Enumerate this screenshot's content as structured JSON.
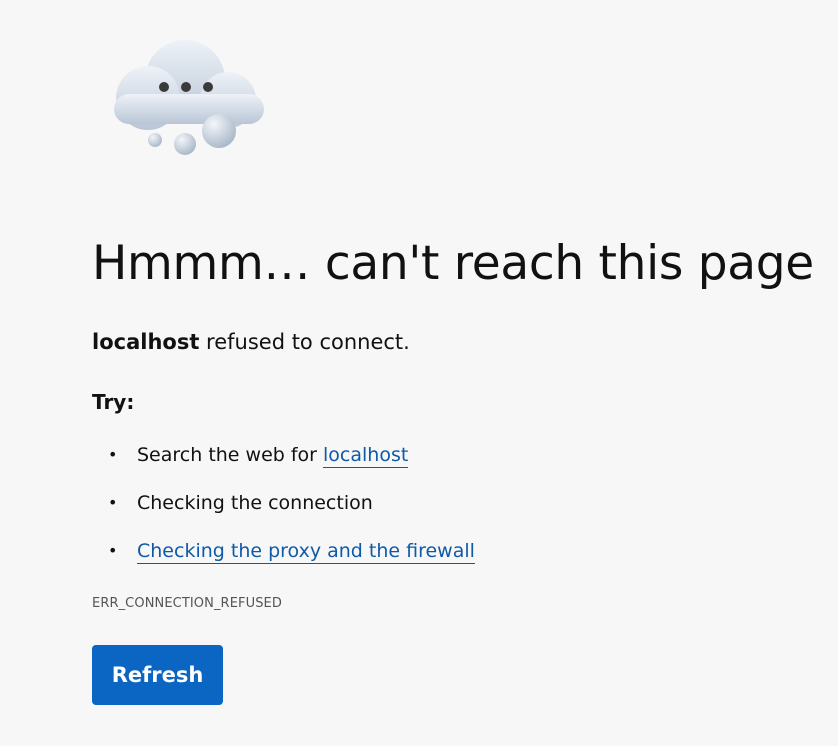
{
  "error_page": {
    "heading": "Hmmm… can't reach this page",
    "host": "localhost",
    "refused_text": " refused to connect.",
    "try_label": "Try:",
    "suggestions": [
      {
        "prefix": "Search the web for ",
        "link": "localhost"
      },
      {
        "text": "Checking the connection"
      },
      {
        "link": "Checking the proxy and the firewall"
      }
    ],
    "bullet": "•",
    "error_code": "ERR_CONNECTION_REFUSED",
    "refresh_label": "Refresh"
  },
  "colors": {
    "background": "#f7f7f7",
    "link": "#0f5aa8",
    "button": "#0a66c2",
    "button_text": "#ffffff"
  },
  "icons": {
    "illustration": "cloud-with-dots-icon"
  }
}
